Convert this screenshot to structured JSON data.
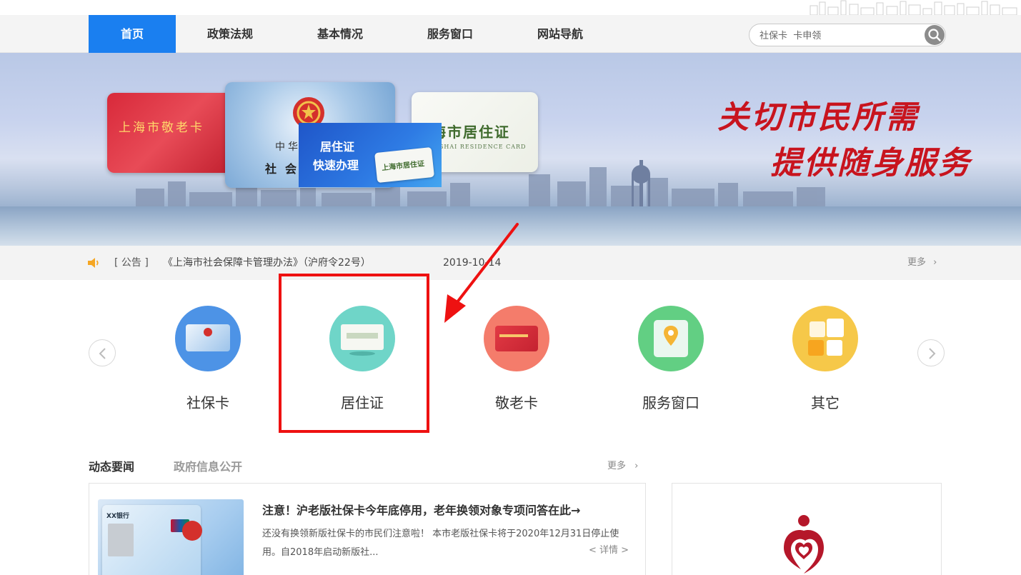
{
  "nav": {
    "items": [
      "首页",
      "政策法规",
      "基本情况",
      "服务窗口",
      "网站导航"
    ],
    "active_index": 0,
    "search_placeholder": "社保卡  卡申领"
  },
  "banner": {
    "slogan_line1": "关切市民所需",
    "slogan_line2": "提供随身服务",
    "promo_line1": "居住证",
    "promo_line2": "快速办理",
    "card_red_text": "上海市敬老卡",
    "card_blue_text1": "中华",
    "card_blue_text2": "社会",
    "card_white_text": "海市居住证",
    "card_white_sub": "NGHAI RESIDENCE CARD",
    "mini_card_text": "上海市居住证"
  },
  "notice": {
    "tag": "[ 公告 ]",
    "title": "《上海市社会保障卡管理办法》（沪府令22号）",
    "date": "2019-10-14",
    "more": "更多"
  },
  "services": [
    {
      "label": "社保卡",
      "icon": "social-security-card-icon",
      "color": "#4a90e2"
    },
    {
      "label": "居住证",
      "icon": "residence-permit-icon",
      "color": "#63d2c4"
    },
    {
      "label": "敬老卡",
      "icon": "senior-card-icon",
      "color": "#f47a6a"
    },
    {
      "label": "服务窗口",
      "icon": "map-pin-icon",
      "color": "#5fcf80"
    },
    {
      "label": "其它",
      "icon": "grid-blocks-icon",
      "color": "#f5c242"
    }
  ],
  "news": {
    "tabs": [
      "动态要闻",
      "政府信息公开"
    ],
    "active_tab": 0,
    "more": "更多",
    "title": "注意！沪老版社保卡今年底停用，老年换领对象专项问答在此→",
    "body": "还没有换领新版社保卡的市民们注意啦！ 本市老版社保卡将于2020年12月31日停止使用。自2018年启动新版社...",
    "detail": "< 详情 >",
    "thumb_bank": "XX银行"
  }
}
